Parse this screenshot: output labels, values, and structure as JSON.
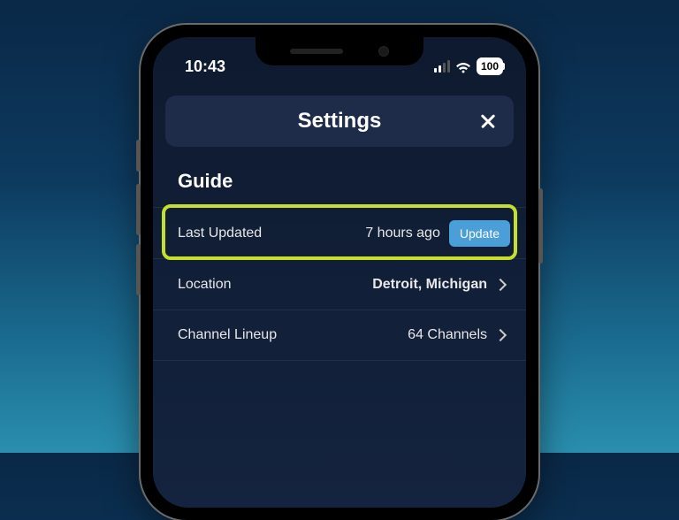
{
  "status": {
    "time": "10:43",
    "battery": "100"
  },
  "header": {
    "title": "Settings"
  },
  "section": {
    "title": "Guide"
  },
  "rows": {
    "last_updated": {
      "label": "Last Updated",
      "value": "7 hours ago",
      "button": "Update"
    },
    "location": {
      "label": "Location",
      "value": "Detroit, Michigan"
    },
    "lineup": {
      "label": "Channel Lineup",
      "value": "64 Channels"
    }
  }
}
